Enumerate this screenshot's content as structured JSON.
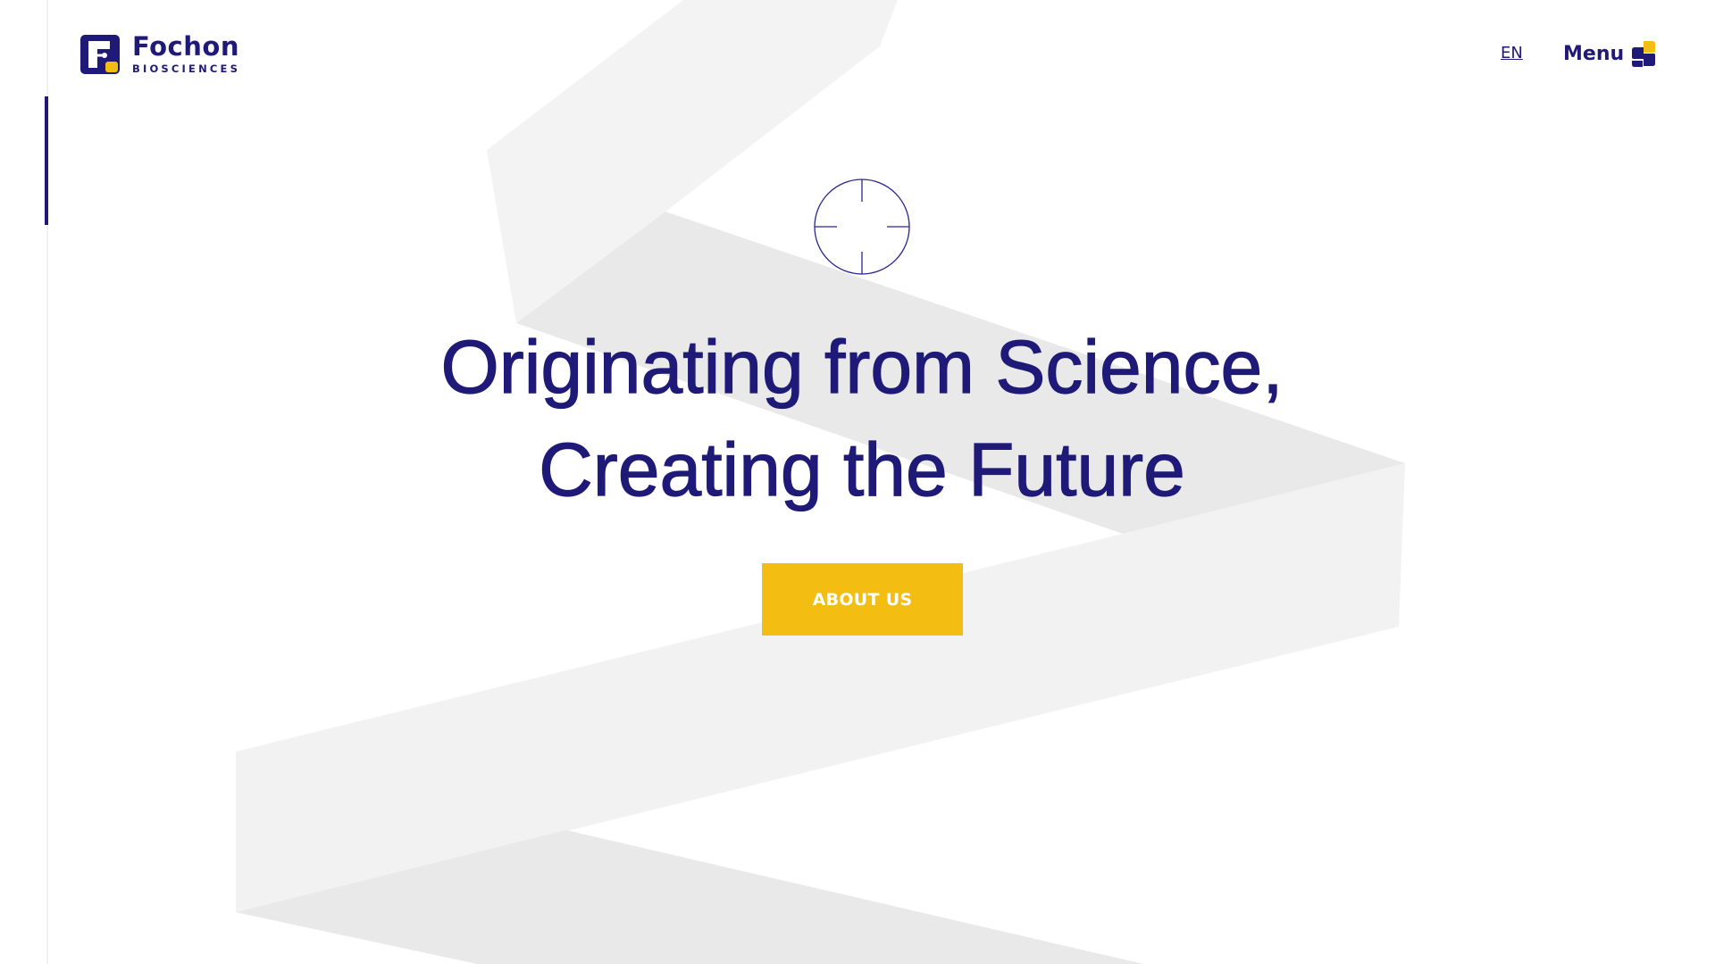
{
  "brand": {
    "name": "Fochon",
    "subtitle": "BIOSCIENCES",
    "primary_color": "#1f1a78",
    "accent_color": "#f4bd12"
  },
  "header": {
    "language": "EN",
    "menu_label": "Menu",
    "menu_icon": "menu-blocks-icon"
  },
  "hero": {
    "icon": "crosshair-icon",
    "title_line1": "Originating from Science,",
    "title_line2": "Creating the Future",
    "cta_label": "ABOUT US"
  },
  "rail": {
    "indicator_color": "#1f1a78"
  }
}
